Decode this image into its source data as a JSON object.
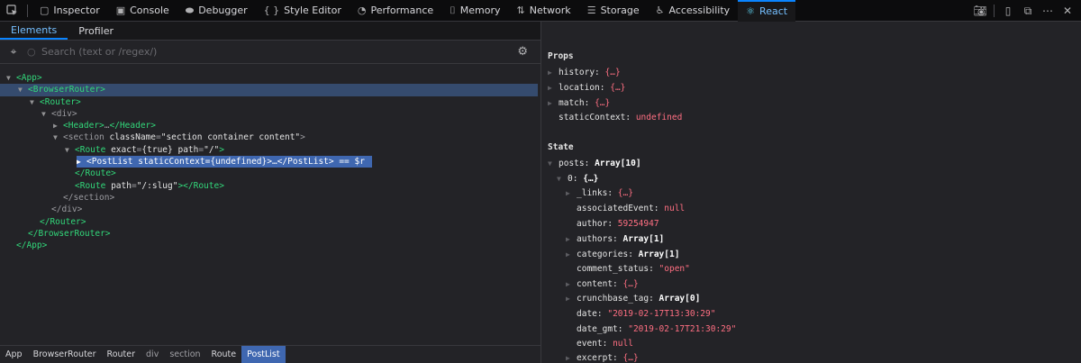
{
  "toolbar": {
    "tabs": [
      {
        "label": "Inspector",
        "icon": "inspector-icon"
      },
      {
        "label": "Console",
        "icon": "console-icon"
      },
      {
        "label": "Debugger",
        "icon": "debugger-icon"
      },
      {
        "label": "Style Editor",
        "icon": "style-editor-icon",
        "glyph": "{ }"
      },
      {
        "label": "Performance",
        "icon": "performance-icon"
      },
      {
        "label": "Memory",
        "icon": "memory-icon"
      },
      {
        "label": "Network",
        "icon": "network-icon"
      },
      {
        "label": "Storage",
        "icon": "storage-icon"
      },
      {
        "label": "Accessibility",
        "icon": "accessibility-icon"
      },
      {
        "label": "React",
        "icon": "react-icon"
      }
    ],
    "active_tab": "React"
  },
  "subtabs": [
    "Elements",
    "Profiler"
  ],
  "search": {
    "placeholder": "Search (text or /regex/)"
  },
  "tree": {
    "app_open": "<App>",
    "browser_router_open": "<BrowserRouter>",
    "router_open": "<Router>",
    "div_open": "<div>",
    "header_open": "<Header>",
    "header_ellipsis": "…",
    "header_close": "</Header>",
    "section_open": "<section",
    "section_attr": "className",
    "section_val": "\"section container content\"",
    "section_end": ">",
    "route_open": "<Route",
    "route_exact": "exact",
    "route_exact_val": "{true}",
    "route_path": "path",
    "route_path_val": "\"/\"",
    "route_end": ">",
    "postlist_open": "<PostList",
    "postlist_attr": "staticContext",
    "postlist_val": "{undefined}",
    "postlist_mid": ">…",
    "postlist_close": "</PostList>",
    "postlist_suffix": " == $r",
    "route_close": "</Route>",
    "route2_open": "<Route",
    "route2_path": "path",
    "route2_val": "\"/:slug\"",
    "route2_mid": "></Route>",
    "section_close": "</section>",
    "div_close": "</div>",
    "router_close": "</Router>",
    "browser_router_close": "</BrowserRouter>",
    "app_close": "</App>"
  },
  "breadcrumbs": [
    "App",
    "BrowserRouter",
    "Router",
    "div",
    "section",
    "Route",
    "PostList"
  ],
  "props": {
    "title": "Props",
    "items": [
      {
        "key": "history",
        "value": "{…}",
        "expandable": true
      },
      {
        "key": "location",
        "value": "{…}",
        "expandable": true
      },
      {
        "key": "match",
        "value": "{…}",
        "expandable": true
      },
      {
        "key": "staticContext",
        "value": "undefined",
        "expandable": false
      }
    ]
  },
  "state": {
    "title": "State",
    "posts_key": "posts",
    "posts_value": "Array[10]",
    "item0_key": "0",
    "item0_value": "{…}",
    "fields": [
      {
        "key": "_links",
        "value": "{…}",
        "expandable": true,
        "kind": "obj"
      },
      {
        "key": "associatedEvent",
        "value": "null",
        "expandable": false,
        "kind": "kw"
      },
      {
        "key": "author",
        "value": "59254947",
        "expandable": false,
        "kind": "num"
      },
      {
        "key": "authors",
        "value": "Array[1]",
        "expandable": true,
        "kind": "bold"
      },
      {
        "key": "categories",
        "value": "Array[1]",
        "expandable": true,
        "kind": "bold"
      },
      {
        "key": "comment_status",
        "value": "\"open\"",
        "expandable": false,
        "kind": "str"
      },
      {
        "key": "content",
        "value": "{…}",
        "expandable": true,
        "kind": "obj"
      },
      {
        "key": "crunchbase_tag",
        "value": "Array[0]",
        "expandable": true,
        "kind": "bold"
      },
      {
        "key": "date",
        "value": "\"2019-02-17T13:30:29\"",
        "expandable": false,
        "kind": "str"
      },
      {
        "key": "date_gmt",
        "value": "\"2019-02-17T21:30:29\"",
        "expandable": false,
        "kind": "str"
      },
      {
        "key": "event",
        "value": "null",
        "expandable": false,
        "kind": "kw"
      },
      {
        "key": "excerpt",
        "value": "{…}",
        "expandable": true,
        "kind": "obj"
      }
    ]
  },
  "colors": {
    "accent": "#0a84ff",
    "tag": "#32d77a",
    "value": "#ff6f82",
    "selection": "#3f67b0"
  }
}
